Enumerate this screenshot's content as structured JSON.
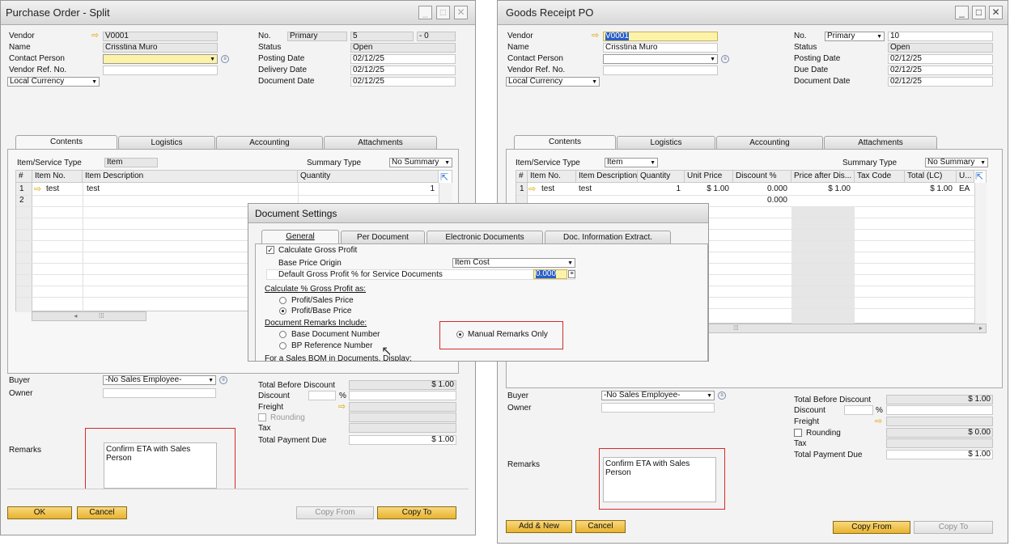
{
  "po": {
    "title": "Purchase Order - Split",
    "vendor_label": "Vendor",
    "vendor": "V0001",
    "name_label": "Name",
    "name": "Crisstina Muro",
    "contact_label": "Contact Person",
    "vendor_ref_label": "Vendor Ref. No.",
    "currency": "Local Currency",
    "no_label": "No.",
    "series": "Primary",
    "no": "5",
    "no_suffix": "- 0",
    "status_label": "Status",
    "status": "Open",
    "posting_label": "Posting Date",
    "posting": "02/12/25",
    "delivery_label": "Delivery Date",
    "delivery": "02/12/25",
    "docdate_label": "Document Date",
    "docdate": "02/12/25",
    "tabs": [
      "Contents",
      "Logistics",
      "Accounting",
      "Attachments"
    ],
    "item_type_label": "Item/Service Type",
    "item_type": "Item",
    "summary_label": "Summary Type",
    "summary": "No Summary",
    "cols": [
      "#",
      "Item No.",
      "Item Description",
      "Quantity"
    ],
    "rows": [
      {
        "n": "1",
        "item": "test",
        "desc": "test",
        "qty": "1"
      },
      {
        "n": "2",
        "item": "",
        "desc": "",
        "qty": ""
      }
    ],
    "buyer_label": "Buyer",
    "buyer": "-No Sales Employee-",
    "owner_label": "Owner",
    "remarks_label": "Remarks",
    "remarks": "Confirm ETA with Sales Person",
    "tbd_label": "Total Before Discount",
    "tbd": "$ 1.00",
    "discount_label": "Discount",
    "pct": "%",
    "freight_label": "Freight",
    "rounding_label": "Rounding",
    "tax_label": "Tax",
    "tpd_label": "Total Payment Due",
    "tpd": "$ 1.00",
    "ok": "OK",
    "cancel": "Cancel",
    "copy_from": "Copy From",
    "copy_to": "Copy To"
  },
  "gr": {
    "title": "Goods Receipt PO",
    "vendor_label": "Vendor",
    "vendor": "V0001",
    "name_label": "Name",
    "name": "Crisstina Muro",
    "contact_label": "Contact Person",
    "vendor_ref_label": "Vendor Ref. No.",
    "currency": "Local Currency",
    "no_label": "No.",
    "series": "Primary",
    "no": "10",
    "status_label": "Status",
    "status": "Open",
    "posting_label": "Posting Date",
    "posting": "02/12/25",
    "due_label": "Due Date",
    "due": "02/12/25",
    "docdate_label": "Document Date",
    "docdate": "02/12/25",
    "tabs": [
      "Contents",
      "Logistics",
      "Accounting",
      "Attachments"
    ],
    "item_type_label": "Item/Service Type",
    "item_type": "Item",
    "summary_label": "Summary Type",
    "summary": "No Summary",
    "cols": [
      "#",
      "Item No.",
      "Item Description",
      "Quantity",
      "Unit Price",
      "Discount %",
      "Price after Dis...",
      "Tax Code",
      "Total (LC)",
      "U..."
    ],
    "row1": {
      "n": "1",
      "item": "test",
      "desc": "test",
      "qty": "1",
      "price": "$ 1.00",
      "disc": "0.000",
      "pad": "$ 1.00",
      "tax": "",
      "total": "$ 1.00",
      "uom": "EA"
    },
    "row2_disc": "0.000",
    "buyer_label": "Buyer",
    "buyer": "-No Sales Employee-",
    "owner_label": "Owner",
    "remarks_label": "Remarks",
    "remarks": "Confirm ETA with Sales Person",
    "tbd_label": "Total Before Discount",
    "tbd": "$ 1.00",
    "discount_label": "Discount",
    "pct": "%",
    "freight_label": "Freight",
    "rounding_label": "Rounding",
    "rounding": "$ 0.00",
    "tax_label": "Tax",
    "tpd_label": "Total Payment Due",
    "tpd": "$ 1.00",
    "add_new": "Add & New",
    "cancel": "Cancel",
    "copy_from": "Copy From",
    "copy_to": "Copy To"
  },
  "ds": {
    "title": "Document Settings",
    "tabs": [
      "General",
      "Per Document",
      "Electronic Documents",
      "Doc. Information Extract."
    ],
    "calc_gp": "Calculate Gross Profit",
    "base_price_label": "Base Price Origin",
    "base_price": "Item Cost",
    "default_gp_label": "Default Gross Profit % for Service Documents",
    "default_gp": "0.000",
    "calc_pct_label": "Calculate % Gross Profit as:",
    "opt_sales": "Profit/Sales Price",
    "opt_base": "Profit/Base Price",
    "remarks_include_label": "Document Remarks Include:",
    "opt_basedoc": "Base Document Number",
    "opt_bpref": "BP Reference Number",
    "opt_manual": "Manual Remarks Only",
    "bom_label": "For a Sales BOM in Documents, Display:"
  },
  "colors": {
    "accent": "#e8b32f",
    "highlight": "#d22b2b"
  }
}
